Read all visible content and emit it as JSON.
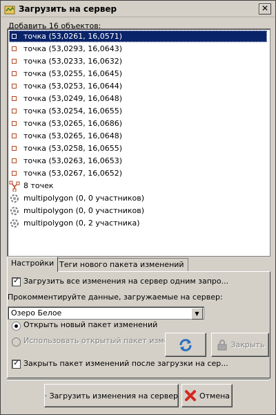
{
  "window": {
    "title": "Загрузить на сервер",
    "close_glyph": "✕"
  },
  "list": {
    "heading": "Добавить 16 объектов:",
    "items": [
      {
        "icon": "node-icon",
        "label": "точка (53,0261, 16,0571)",
        "selected": true
      },
      {
        "icon": "node-icon",
        "label": "точка (53,0293, 16,0643)"
      },
      {
        "icon": "node-icon",
        "label": "точка (53,0233, 16,0632)"
      },
      {
        "icon": "node-icon",
        "label": "точка (53,0255, 16,0645)"
      },
      {
        "icon": "node-icon",
        "label": "точка (53,0253, 16,0644)"
      },
      {
        "icon": "node-icon",
        "label": "точка (53,0249, 16,0648)"
      },
      {
        "icon": "node-icon",
        "label": "точка (53,0254, 16,0655)"
      },
      {
        "icon": "node-icon",
        "label": "точка (53,0265, 16,0686)"
      },
      {
        "icon": "node-icon",
        "label": "точка (53,0265, 16,0648)"
      },
      {
        "icon": "node-icon",
        "label": "точка (53,0258, 16,0655)"
      },
      {
        "icon": "node-icon",
        "label": "точка (53,0263, 16,0653)"
      },
      {
        "icon": "node-icon",
        "label": "точка (53,0267, 16,0652)"
      },
      {
        "icon": "way-icon",
        "label": "8 точек"
      },
      {
        "icon": "relation-icon",
        "label": "multipolygon (0, 0 участников)"
      },
      {
        "icon": "relation-icon",
        "label": "multipolygon (0, 0 участников)"
      },
      {
        "icon": "relation-icon",
        "label": "multipolygon (0, 2 участника)"
      }
    ]
  },
  "tabs": [
    {
      "label": "Настройки",
      "active": true
    },
    {
      "label": "Теги нового пакета изменений",
      "active": false
    }
  ],
  "settings": {
    "upload_all_label": "Загрузить все изменения на сервер одним запро...",
    "comment_label": "Прокомментируйте данные, загружаемые на сервер:",
    "comment_value": "Озеро Белое",
    "open_new_label": "Открыть новый пакет изменений",
    "use_existing_label": "Использовать открытый пакет изме...",
    "refresh_icon": "refresh-icon",
    "close_changeset_label": "Закрыть",
    "close_after_label": "Закрыть пакет изменений после загрузки на сер..."
  },
  "footer": {
    "upload_label": "Загрузить изменения на сервер",
    "cancel_label": "Отмена"
  },
  "colors": {
    "selection": "#0a246a",
    "node": "#b0451e",
    "cancel": "#d4271f",
    "upload": "#3a9a3a"
  }
}
